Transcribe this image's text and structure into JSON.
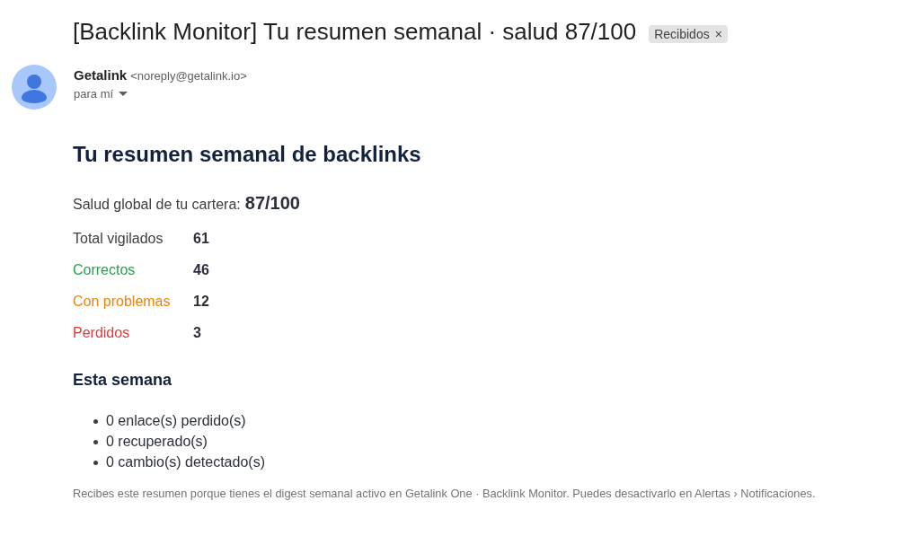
{
  "email": {
    "subject": "[Backlink Monitor] Tu resumen semanal · salud 87/100",
    "label": {
      "text": "Recibidos",
      "remove": "×"
    },
    "sender": {
      "name": "Getalink",
      "address": "<noreply@getalink.io>",
      "recipient": "para mí"
    }
  },
  "body": {
    "heading": "Tu resumen semanal de backlinks",
    "health": {
      "label": "Salud global de tu cartera:",
      "value": "87/100"
    },
    "stats": [
      {
        "label": "Total vigilados",
        "value": "61",
        "color": "#3c4043"
      },
      {
        "label": "Correctos",
        "value": "46",
        "color": "#1ea446"
      },
      {
        "label": "Con problemas",
        "value": "12",
        "color": "#e8830c"
      },
      {
        "label": "Perdidos",
        "value": "3",
        "color": "#e5383b"
      }
    ],
    "week_heading": "Esta semana",
    "week_items": [
      "0 enlace(s) perdido(s)",
      "0 recuperado(s)",
      "0 cambio(s) detectado(s)"
    ],
    "footer": "Recibes este resumen porque tienes el digest semanal activo en Getalink One · Backlink Monitor. Puedes desactivarlo en Alertas › Notificaciones."
  }
}
